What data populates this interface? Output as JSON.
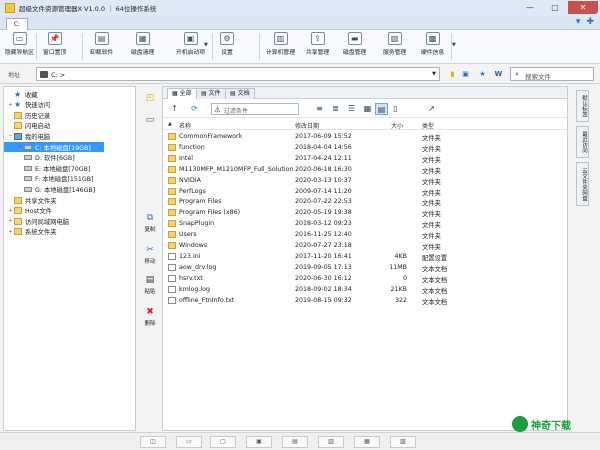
{
  "window": {
    "title": "超级文件资源管理器X V1.0.0 ｜ 64位操作系统",
    "min": "—",
    "max": "▢",
    "close": "✕"
  },
  "tabs": {
    "active": "C:",
    "right_icons": [
      "▾",
      "✚"
    ]
  },
  "toolbar": [
    {
      "label": "隐藏导航区",
      "icon": "▭"
    },
    {
      "label": "窗口置顶",
      "icon": "📌"
    },
    {
      "label": "卸载软件",
      "icon": "▤"
    },
    {
      "label": "磁盘清理",
      "icon": "▦"
    },
    {
      "label": "开机启动项",
      "icon": "▣"
    },
    {
      "label": "设置",
      "icon": "⚙"
    },
    {
      "label": "计算机管理",
      "icon": "▥"
    },
    {
      "label": "共享管理",
      "icon": "⇪"
    },
    {
      "label": "磁盘管理",
      "icon": "▬"
    },
    {
      "label": "服务管理",
      "icon": "▧"
    },
    {
      "label": "硬件信息",
      "icon": "▩"
    }
  ],
  "address": {
    "label": "地址",
    "value": "C: >",
    "search_placeholder": "搜索文件",
    "icons": [
      "▮",
      "▣",
      "★",
      "W"
    ]
  },
  "tree": [
    {
      "label": "收藏",
      "icon": "star",
      "level": 0,
      "ex": ""
    },
    {
      "label": "快速访问",
      "icon": "star",
      "level": 0,
      "ex": "+"
    },
    {
      "label": "历史记录",
      "icon": "folder",
      "level": 0,
      "ex": ""
    },
    {
      "label": "闪电启动",
      "icon": "folder",
      "level": 0,
      "ex": ""
    },
    {
      "label": "我的电脑",
      "icon": "pc",
      "level": 0,
      "ex": "−"
    },
    {
      "label": "C: 本地磁盘[19GB]",
      "icon": "drive",
      "level": 1,
      "ex": "+",
      "selected": true
    },
    {
      "label": "D: 软件[6GB]",
      "icon": "drive",
      "level": 1,
      "ex": ""
    },
    {
      "label": "E: 本地磁盘[70GB]",
      "icon": "drive",
      "level": 1,
      "ex": ""
    },
    {
      "label": "F: 本地磁盘[151GB]",
      "icon": "drive",
      "level": 1,
      "ex": ""
    },
    {
      "label": "G: 本地磁盘[146GB]",
      "icon": "drive",
      "level": 1,
      "ex": ""
    },
    {
      "label": "共享文件夹",
      "icon": "folder",
      "level": 0,
      "ex": ""
    },
    {
      "label": "Host文件",
      "icon": "folder",
      "level": 0,
      "ex": "+"
    },
    {
      "label": "访问局域网电脑",
      "icon": "folder",
      "level": 0,
      "ex": "+"
    },
    {
      "label": "系统文件夹",
      "icon": "folder",
      "level": 0,
      "ex": "+"
    }
  ],
  "left_actions": [
    {
      "label": "",
      "icon": "◰"
    },
    {
      "label": "",
      "icon": "▭"
    },
    {
      "label": "复制",
      "icon": "⧉"
    },
    {
      "label": "移动",
      "icon": "✂"
    },
    {
      "label": "粘贴",
      "icon": "▤"
    },
    {
      "label": "删除",
      "icon": "✖"
    }
  ],
  "pane_tabs": [
    "全部",
    "文件",
    "文档"
  ],
  "filter_placeholder": "过滤条件",
  "pane_tool_icons": [
    "↑",
    "⟳"
  ],
  "view_icons": [
    "≡",
    "≣",
    "☰",
    "▦",
    "▤",
    "▯",
    "↗"
  ],
  "columns": {
    "name": "名称",
    "date": "修改日期",
    "size": "大小",
    "type": "类型"
  },
  "files": [
    {
      "name": "CommonFramework",
      "date": "2017-06-09 15:52",
      "size": "",
      "type": "文件夹",
      "kind": "folder"
    },
    {
      "name": "function",
      "date": "2018-04-04 14:56",
      "size": "",
      "type": "文件夹",
      "kind": "folder"
    },
    {
      "name": "Intel",
      "date": "2017-04-24 12:11",
      "size": "",
      "type": "文件夹",
      "kind": "folder"
    },
    {
      "name": "M1130MFP_M1210MFP_Full_Solution",
      "date": "2020-06-18 16:30",
      "size": "",
      "type": "文件夹",
      "kind": "folder"
    },
    {
      "name": "NVIDIA",
      "date": "2020-03-13 10:37",
      "size": "",
      "type": "文件夹",
      "kind": "folder"
    },
    {
      "name": "PerfLogs",
      "date": "2009-07-14 11:20",
      "size": "",
      "type": "文件夹",
      "kind": "folder"
    },
    {
      "name": "Program Files",
      "date": "2020-07-22 22:53",
      "size": "",
      "type": "文件夹",
      "kind": "folder"
    },
    {
      "name": "Program Files (x86)",
      "date": "2020-05-19 19:38",
      "size": "",
      "type": "文件夹",
      "kind": "folder"
    },
    {
      "name": "SnapPlugin",
      "date": "2018-03-12 09:23",
      "size": "",
      "type": "文件夹",
      "kind": "folder"
    },
    {
      "name": "Users",
      "date": "2016-11-25 12:40",
      "size": "",
      "type": "文件夹",
      "kind": "folder"
    },
    {
      "name": "Windows",
      "date": "2020-07-27 23:18",
      "size": "",
      "type": "文件夹",
      "kind": "folder"
    },
    {
      "name": "123.ini",
      "date": "2017-11-20 16:41",
      "size": "4KB",
      "type": "配置设置",
      "kind": "file"
    },
    {
      "name": "aow_drv.log",
      "date": "2019-09-05 17:13",
      "size": "11MB",
      "type": "文本文档",
      "kind": "file"
    },
    {
      "name": "hsrv.txt",
      "date": "2020-06-30 16:12",
      "size": "0",
      "type": "文本文档",
      "kind": "file"
    },
    {
      "name": "kmlog.log",
      "date": "2018-09-02 18:34",
      "size": "21KB",
      "type": "文本文档",
      "kind": "file"
    },
    {
      "name": "offline_FtnInfo.txt",
      "date": "2019-08-15 09:32",
      "size": "322",
      "type": "文本文档",
      "kind": "file"
    }
  ],
  "right_tabs": [
    "默认标签",
    "最近访问",
    "云文件夹网盘"
  ],
  "status_icons": [
    "◫",
    "▭",
    "▢",
    "▣",
    "▤",
    "▥",
    "▦",
    "▧"
  ],
  "watermark": "神奇下载"
}
